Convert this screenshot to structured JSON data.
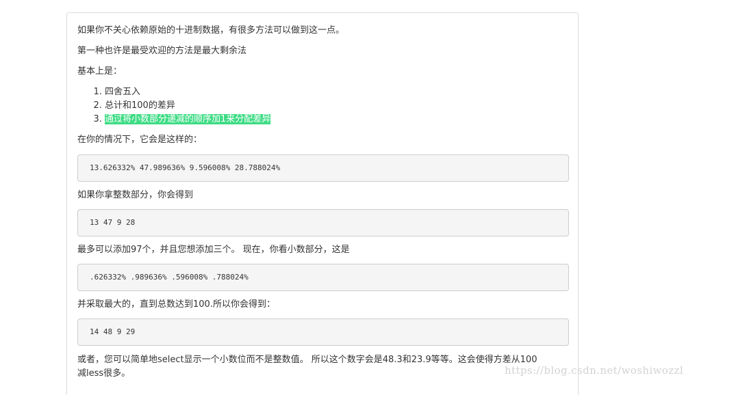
{
  "article": {
    "intro": "如果你不关心依赖原始的十进制数据，有很多方法可以做到这一点。",
    "method": "第一种也许是最受欢迎的方法是最大剩余法",
    "basic": "基本上是：",
    "steps": [
      "四舍五入",
      "总计和100的差异",
      "通过将小数部分递减的顺序加1来分配差异"
    ],
    "case_intro": "在你的情况下，它会是这样的：",
    "code1": "13.626332% 47.989636% 9.596008% 28.788024%",
    "integer_intro": "如果你拿整数部分，你会得到",
    "code2": "13 47 9 28",
    "add_text": "最多可以添加97个，并且您想添加三个。 现在，你看小数部分，这是",
    "code3": ".626332% .989636% .596008% .788024%",
    "take_text": "并采取最大的，直到总数达到100.所以你会得到：",
    "code4": "14 48 9 29",
    "alt_text_line1": "或者，您可以简单地select显示一个小数位而不是整数值。 所以这个数字会是48.3和23.9等等。这会使得方差从100",
    "alt_text_line2": "减less很多。"
  },
  "watermark": "https://blog.csdn.net/woshiwozzl",
  "colors": {
    "highlight": "#3ddc84",
    "code_bg": "#f5f5f5",
    "text": "#333333"
  }
}
